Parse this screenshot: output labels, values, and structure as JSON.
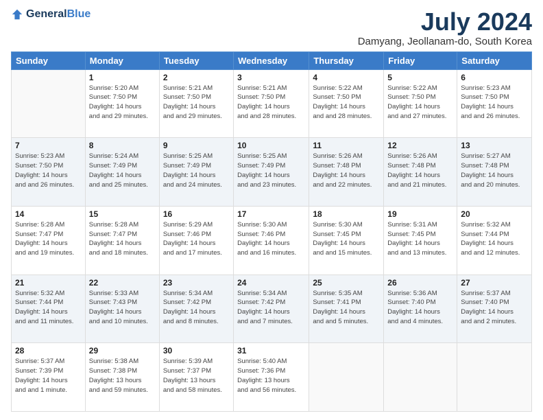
{
  "logo": {
    "general": "General",
    "blue": "Blue"
  },
  "title": "July 2024",
  "location": "Damyang, Jeollanam-do, South Korea",
  "headers": [
    "Sunday",
    "Monday",
    "Tuesday",
    "Wednesday",
    "Thursday",
    "Friday",
    "Saturday"
  ],
  "weeks": [
    [
      {
        "day": "",
        "sunrise": "",
        "sunset": "",
        "daylight": ""
      },
      {
        "day": "1",
        "sunrise": "Sunrise: 5:20 AM",
        "sunset": "Sunset: 7:50 PM",
        "daylight": "Daylight: 14 hours and 29 minutes."
      },
      {
        "day": "2",
        "sunrise": "Sunrise: 5:21 AM",
        "sunset": "Sunset: 7:50 PM",
        "daylight": "Daylight: 14 hours and 29 minutes."
      },
      {
        "day": "3",
        "sunrise": "Sunrise: 5:21 AM",
        "sunset": "Sunset: 7:50 PM",
        "daylight": "Daylight: 14 hours and 28 minutes."
      },
      {
        "day": "4",
        "sunrise": "Sunrise: 5:22 AM",
        "sunset": "Sunset: 7:50 PM",
        "daylight": "Daylight: 14 hours and 28 minutes."
      },
      {
        "day": "5",
        "sunrise": "Sunrise: 5:22 AM",
        "sunset": "Sunset: 7:50 PM",
        "daylight": "Daylight: 14 hours and 27 minutes."
      },
      {
        "day": "6",
        "sunrise": "Sunrise: 5:23 AM",
        "sunset": "Sunset: 7:50 PM",
        "daylight": "Daylight: 14 hours and 26 minutes."
      }
    ],
    [
      {
        "day": "7",
        "sunrise": "Sunrise: 5:23 AM",
        "sunset": "Sunset: 7:50 PM",
        "daylight": "Daylight: 14 hours and 26 minutes."
      },
      {
        "day": "8",
        "sunrise": "Sunrise: 5:24 AM",
        "sunset": "Sunset: 7:49 PM",
        "daylight": "Daylight: 14 hours and 25 minutes."
      },
      {
        "day": "9",
        "sunrise": "Sunrise: 5:25 AM",
        "sunset": "Sunset: 7:49 PM",
        "daylight": "Daylight: 14 hours and 24 minutes."
      },
      {
        "day": "10",
        "sunrise": "Sunrise: 5:25 AM",
        "sunset": "Sunset: 7:49 PM",
        "daylight": "Daylight: 14 hours and 23 minutes."
      },
      {
        "day": "11",
        "sunrise": "Sunrise: 5:26 AM",
        "sunset": "Sunset: 7:48 PM",
        "daylight": "Daylight: 14 hours and 22 minutes."
      },
      {
        "day": "12",
        "sunrise": "Sunrise: 5:26 AM",
        "sunset": "Sunset: 7:48 PM",
        "daylight": "Daylight: 14 hours and 21 minutes."
      },
      {
        "day": "13",
        "sunrise": "Sunrise: 5:27 AM",
        "sunset": "Sunset: 7:48 PM",
        "daylight": "Daylight: 14 hours and 20 minutes."
      }
    ],
    [
      {
        "day": "14",
        "sunrise": "Sunrise: 5:28 AM",
        "sunset": "Sunset: 7:47 PM",
        "daylight": "Daylight: 14 hours and 19 minutes."
      },
      {
        "day": "15",
        "sunrise": "Sunrise: 5:28 AM",
        "sunset": "Sunset: 7:47 PM",
        "daylight": "Daylight: 14 hours and 18 minutes."
      },
      {
        "day": "16",
        "sunrise": "Sunrise: 5:29 AM",
        "sunset": "Sunset: 7:46 PM",
        "daylight": "Daylight: 14 hours and 17 minutes."
      },
      {
        "day": "17",
        "sunrise": "Sunrise: 5:30 AM",
        "sunset": "Sunset: 7:46 PM",
        "daylight": "Daylight: 14 hours and 16 minutes."
      },
      {
        "day": "18",
        "sunrise": "Sunrise: 5:30 AM",
        "sunset": "Sunset: 7:45 PM",
        "daylight": "Daylight: 14 hours and 15 minutes."
      },
      {
        "day": "19",
        "sunrise": "Sunrise: 5:31 AM",
        "sunset": "Sunset: 7:45 PM",
        "daylight": "Daylight: 14 hours and 13 minutes."
      },
      {
        "day": "20",
        "sunrise": "Sunrise: 5:32 AM",
        "sunset": "Sunset: 7:44 PM",
        "daylight": "Daylight: 14 hours and 12 minutes."
      }
    ],
    [
      {
        "day": "21",
        "sunrise": "Sunrise: 5:32 AM",
        "sunset": "Sunset: 7:44 PM",
        "daylight": "Daylight: 14 hours and 11 minutes."
      },
      {
        "day": "22",
        "sunrise": "Sunrise: 5:33 AM",
        "sunset": "Sunset: 7:43 PM",
        "daylight": "Daylight: 14 hours and 10 minutes."
      },
      {
        "day": "23",
        "sunrise": "Sunrise: 5:34 AM",
        "sunset": "Sunset: 7:42 PM",
        "daylight": "Daylight: 14 hours and 8 minutes."
      },
      {
        "day": "24",
        "sunrise": "Sunrise: 5:34 AM",
        "sunset": "Sunset: 7:42 PM",
        "daylight": "Daylight: 14 hours and 7 minutes."
      },
      {
        "day": "25",
        "sunrise": "Sunrise: 5:35 AM",
        "sunset": "Sunset: 7:41 PM",
        "daylight": "Daylight: 14 hours and 5 minutes."
      },
      {
        "day": "26",
        "sunrise": "Sunrise: 5:36 AM",
        "sunset": "Sunset: 7:40 PM",
        "daylight": "Daylight: 14 hours and 4 minutes."
      },
      {
        "day": "27",
        "sunrise": "Sunrise: 5:37 AM",
        "sunset": "Sunset: 7:40 PM",
        "daylight": "Daylight: 14 hours and 2 minutes."
      }
    ],
    [
      {
        "day": "28",
        "sunrise": "Sunrise: 5:37 AM",
        "sunset": "Sunset: 7:39 PM",
        "daylight": "Daylight: 14 hours and 1 minute."
      },
      {
        "day": "29",
        "sunrise": "Sunrise: 5:38 AM",
        "sunset": "Sunset: 7:38 PM",
        "daylight": "Daylight: 13 hours and 59 minutes."
      },
      {
        "day": "30",
        "sunrise": "Sunrise: 5:39 AM",
        "sunset": "Sunset: 7:37 PM",
        "daylight": "Daylight: 13 hours and 58 minutes."
      },
      {
        "day": "31",
        "sunrise": "Sunrise: 5:40 AM",
        "sunset": "Sunset: 7:36 PM",
        "daylight": "Daylight: 13 hours and 56 minutes."
      },
      {
        "day": "",
        "sunrise": "",
        "sunset": "",
        "daylight": ""
      },
      {
        "day": "",
        "sunrise": "",
        "sunset": "",
        "daylight": ""
      },
      {
        "day": "",
        "sunrise": "",
        "sunset": "",
        "daylight": ""
      }
    ]
  ]
}
